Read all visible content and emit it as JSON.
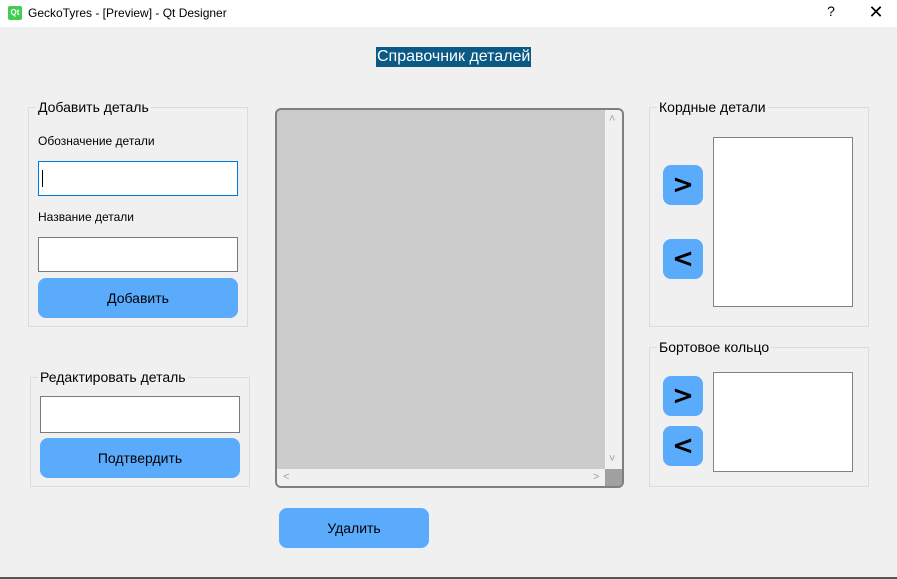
{
  "window": {
    "title": "GeckoTyres - [Preview] - Qt Designer",
    "app_icon_text": "Qt",
    "help_label": "?",
    "close_label": "✕"
  },
  "heading": "Справочник деталей",
  "add_detail": {
    "title": "Добавить деталь",
    "designation_label": "Обозначение детали",
    "designation_value": "",
    "name_label": "Название детали",
    "name_value": "",
    "add_button": "Добавить"
  },
  "edit_detail": {
    "title": "Редактировать деталь",
    "value": "",
    "confirm_button": "Подтвердить"
  },
  "table": {
    "scroll_up": "˄",
    "scroll_down": "˅",
    "scroll_left": "˂",
    "scroll_right": "˃"
  },
  "delete_button": "Удалить",
  "cord_details": {
    "title": "Кордные детали",
    "move_right": ">",
    "move_left": "<",
    "items": []
  },
  "bead_ring": {
    "title": "Бортовое кольцо",
    "move_right": ">",
    "move_left": "<",
    "items": []
  },
  "colors": {
    "button_blue": "#5aabfc",
    "heading_bg": "#0b5a85",
    "focus_border": "#0078d7"
  }
}
